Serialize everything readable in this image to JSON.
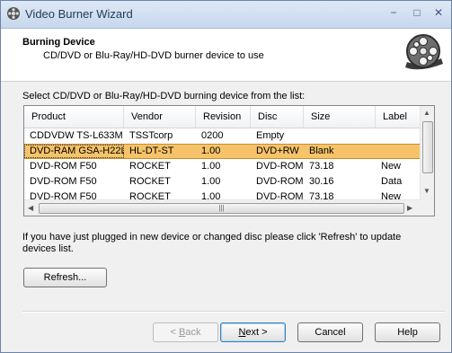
{
  "window": {
    "title": "Video Burner Wizard",
    "minimize": "−",
    "maximize": "□",
    "close": "✕"
  },
  "header": {
    "title": "Burning Device",
    "subtitle": "CD/DVD or Blu-Ray/HD-DVD burner device to use",
    "logo_icon": "film-reel-icon"
  },
  "instruction": "Select CD/DVD or Blu-Ray/HD-DVD burning device from the list:",
  "list": {
    "columns": [
      "Product",
      "Vendor",
      "Revision",
      "Disc",
      "Size",
      "Label"
    ],
    "rows": [
      [
        "CDDVDW TS-L633M",
        "TSSTcorp",
        "0200",
        "Empty",
        "",
        ""
      ],
      [
        "DVD-RAM GSA-H22L",
        "HL-DT-ST",
        "1.00",
        "DVD+RW",
        "Blank",
        ""
      ],
      [
        "DVD-ROM F50",
        "ROCKET",
        "1.00",
        "DVD-ROM",
        "73.18",
        "New"
      ],
      [
        "DVD-ROM F50",
        "ROCKET",
        "1.00",
        "DVD-ROM",
        "30.16",
        "Data"
      ],
      [
        "DVD-ROM F50",
        "ROCKET",
        "1.00",
        "DVD-ROM",
        "73.18",
        "New"
      ]
    ],
    "selected_row": 1,
    "selected_color": "#f6c36a"
  },
  "hint": "If you have just plugged in new device or changed disc please click 'Refresh' to update devices list.",
  "buttons": {
    "refresh": "Refresh...",
    "back_pre": "< ",
    "back_key": "B",
    "back_post": "ack",
    "next_key": "N",
    "next_post": "ext >",
    "cancel": "Cancel",
    "help": "Help"
  }
}
